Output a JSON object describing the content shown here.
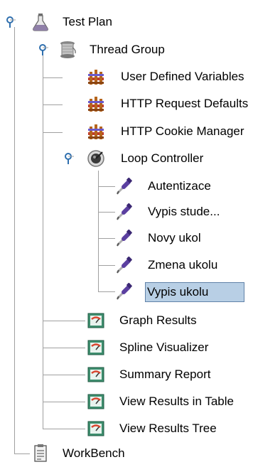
{
  "tree": {
    "root": {
      "label": "Test Plan",
      "icon": "flask-icon"
    },
    "thread_group": {
      "label": "Thread Group",
      "icon": "spool-icon"
    },
    "config": [
      {
        "label": "User Defined Variables",
        "icon": "config-element-icon"
      },
      {
        "label": "HTTP Request Defaults",
        "icon": "config-element-icon"
      },
      {
        "label": "HTTP Cookie Manager",
        "icon": "config-element-icon"
      }
    ],
    "loop_controller": {
      "label": "Loop Controller",
      "icon": "loop-controller-icon"
    },
    "samplers": [
      {
        "label": "Autentizace",
        "icon": "pipette-icon"
      },
      {
        "label": "Vypis stude...",
        "icon": "pipette-icon"
      },
      {
        "label": "Novy ukol",
        "icon": "pipette-icon"
      },
      {
        "label": "Zmena ukolu",
        "icon": "pipette-icon"
      },
      {
        "label": "Vypis ukolu",
        "icon": "pipette-icon",
        "selected": true
      }
    ],
    "listeners": [
      {
        "label": "Graph Results",
        "icon": "listener-graph-icon"
      },
      {
        "label": "Spline Visualizer",
        "icon": "listener-graph-icon"
      },
      {
        "label": "Summary Report",
        "icon": "listener-graph-icon"
      },
      {
        "label": "View Results in Table",
        "icon": "listener-graph-icon"
      },
      {
        "label": "View Results Tree",
        "icon": "listener-graph-icon"
      }
    ],
    "workbench": {
      "label": "WorkBench",
      "icon": "workbench-icon"
    }
  },
  "colors": {
    "selection_bg": "#b8cfe5",
    "selection_border": "#6182a8",
    "tree_lines": "#a0a0a0",
    "expander": "#2f6fae"
  }
}
